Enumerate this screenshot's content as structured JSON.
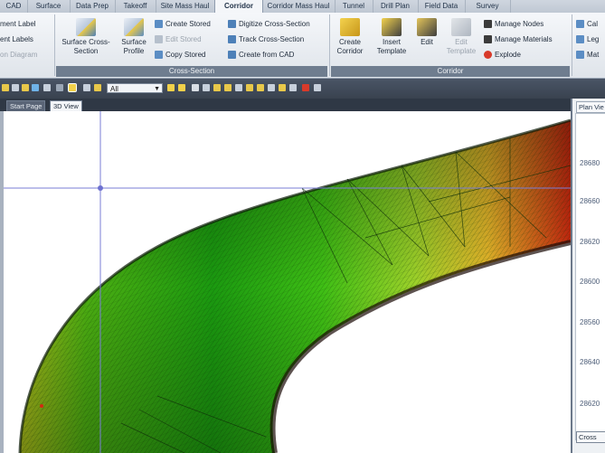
{
  "ribbon_tabs": [
    "CAD",
    "Surface",
    "Data Prep",
    "Takeoff",
    "Site Mass Haul",
    "Corridor",
    "Corridor Mass Haul",
    "Tunnel",
    "Drill Plan",
    "Field Data",
    "Survey"
  ],
  "active_tab": "Corridor",
  "left_partial": [
    "ment Label",
    "ent Labels",
    "on Diagram"
  ],
  "cross_section": {
    "group_label": "Cross-Section",
    "surface_cross_section": "Surface Cross-Section",
    "surface_profile": "Surface Profile",
    "create_stored": "Create Stored",
    "edit_stored": "Edit Stored",
    "copy_stored": "Copy Stored",
    "digitize": "Digitize Cross-Section",
    "track": "Track Cross-Section",
    "create_from_cad": "Create from CAD"
  },
  "corridor": {
    "group_label": "Corridor",
    "create_corridor": "Create Corridor",
    "insert_template": "Insert Template",
    "edit": "Edit",
    "edit_template": "Edit Template",
    "manage_nodes": "Manage Nodes",
    "manage_materials": "Manage Materials",
    "explode": "Explode"
  },
  "right_partial": [
    "Cal",
    "Leg",
    "Mat"
  ],
  "toolbar": {
    "layer_select": "All"
  },
  "doc_tabs": [
    "Start Page",
    "3D View"
  ],
  "active_doc_tab": "3D View",
  "plan_view": {
    "title": "Plan Vie",
    "y_ticks": [
      "28680",
      "28660",
      "28620",
      "28600",
      "28560",
      "28640",
      "28620"
    ],
    "bottom_button": "Cross"
  },
  "colors": {
    "accent_tab": "#f4f6f9",
    "toolbar": "#39424f",
    "surface_green": "#1fbf10",
    "surface_red": "#d42a10",
    "crosshair": "#7a7dd6"
  }
}
